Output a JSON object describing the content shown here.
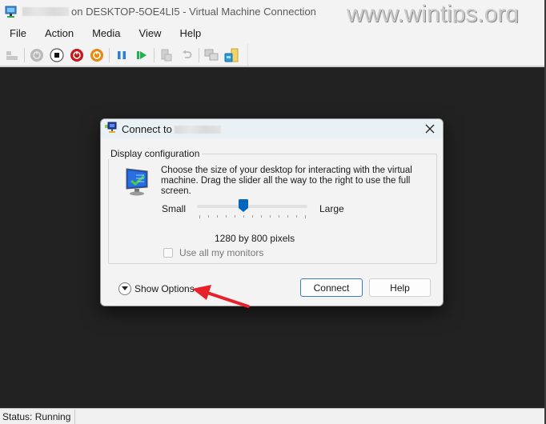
{
  "window": {
    "title_suffix": "on DESKTOP-5OE4LI5 - Virtual Machine Connection",
    "app_icon": "vm-connection-icon",
    "watermark": "www.wintips.org"
  },
  "menu": {
    "items": [
      {
        "label": "File"
      },
      {
        "label": "Action"
      },
      {
        "label": "Media"
      },
      {
        "label": "View"
      },
      {
        "label": "Help"
      }
    ]
  },
  "toolbar": {
    "buttons": [
      {
        "icon": "ctrl-alt-del-icon",
        "enabled": false
      },
      {
        "icon": "start-icon",
        "enabled": false
      },
      {
        "icon": "turn-off-icon",
        "enabled": true
      },
      {
        "icon": "shut-down-icon",
        "enabled": true
      },
      {
        "icon": "save-icon",
        "enabled": true
      },
      {
        "icon": "pause-icon",
        "enabled": true
      },
      {
        "icon": "resume-icon",
        "enabled": true
      },
      {
        "icon": "checkpoint-icon",
        "enabled": false
      },
      {
        "icon": "revert-icon",
        "enabled": false
      },
      {
        "icon": "enhanced-session-icon",
        "enabled": false
      },
      {
        "icon": "share-icon",
        "enabled": true
      }
    ]
  },
  "dialog": {
    "title": "Connect to",
    "group_label": "Display configuration",
    "description": "Choose the size of your desktop for interacting with the virtual machine. Drag the slider all the way to the right to use the full screen.",
    "slider": {
      "min_label": "Small",
      "max_label": "Large",
      "tick_count": 13,
      "position_index": 5
    },
    "resolution": "1280 by 800 pixels",
    "use_all_monitors": {
      "label": "Use all my monitors",
      "checked": false,
      "enabled": false
    },
    "show_options_label": "Show Options",
    "buttons": {
      "connect": "Connect",
      "help": "Help"
    }
  },
  "status": {
    "text": "Status: Running"
  },
  "colors": {
    "accent": "#0067c0",
    "annotation_arrow": "#e8202a",
    "vm_background": "#222222"
  }
}
